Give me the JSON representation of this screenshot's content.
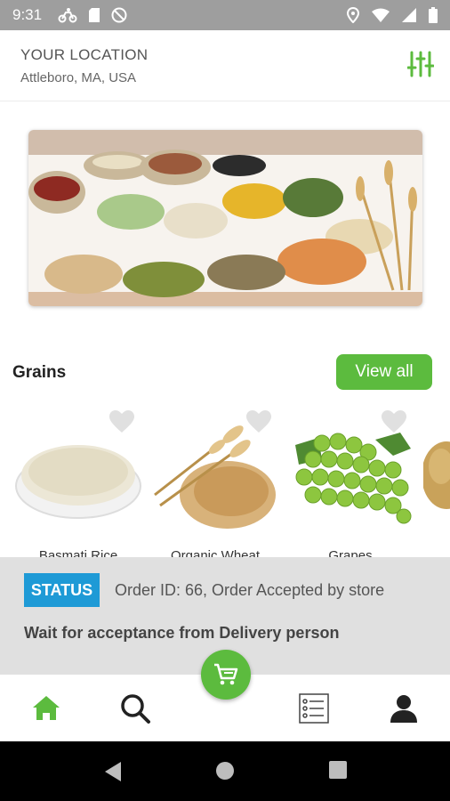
{
  "status_bar": {
    "time": "9:31",
    "left_icons": [
      "bike-delivery-icon",
      "sd-card-icon",
      "do-not-disturb-icon"
    ],
    "right_icons": [
      "location-pin-icon",
      "wifi-icon",
      "signal-icon",
      "battery-icon"
    ]
  },
  "header": {
    "location_label": "YOUR LOCATION",
    "location_value": "Attleboro, MA, USA",
    "filter_icon": "sliders-icon"
  },
  "banner": {
    "subject": "Grains and pulses"
  },
  "grains": {
    "title": "Grains",
    "view_all_label": "View all",
    "products": [
      {
        "name": "Basmati Rice",
        "icon": "heart-icon"
      },
      {
        "name": "Organic Wheat",
        "icon": "heart-icon"
      },
      {
        "name": "Grapes",
        "icon": "heart-icon"
      },
      {
        "name": "",
        "icon": "potato-image"
      }
    ]
  },
  "order_status": {
    "badge": "STATUS",
    "order_text": "Order ID: 66, Order Accepted by store",
    "wait_text": "Wait for acceptance from Delivery person"
  },
  "bottom_nav": {
    "items": [
      "home-icon",
      "search-icon",
      "cart-icon",
      "orders-list-icon",
      "profile-icon"
    ],
    "active": "home-icon"
  },
  "colors": {
    "accent_green": "#5cbb3e",
    "status_blue": "#1e9ad6",
    "status_bar_gray": "#9e9e9e",
    "panel_gray": "#e0e0e0"
  }
}
